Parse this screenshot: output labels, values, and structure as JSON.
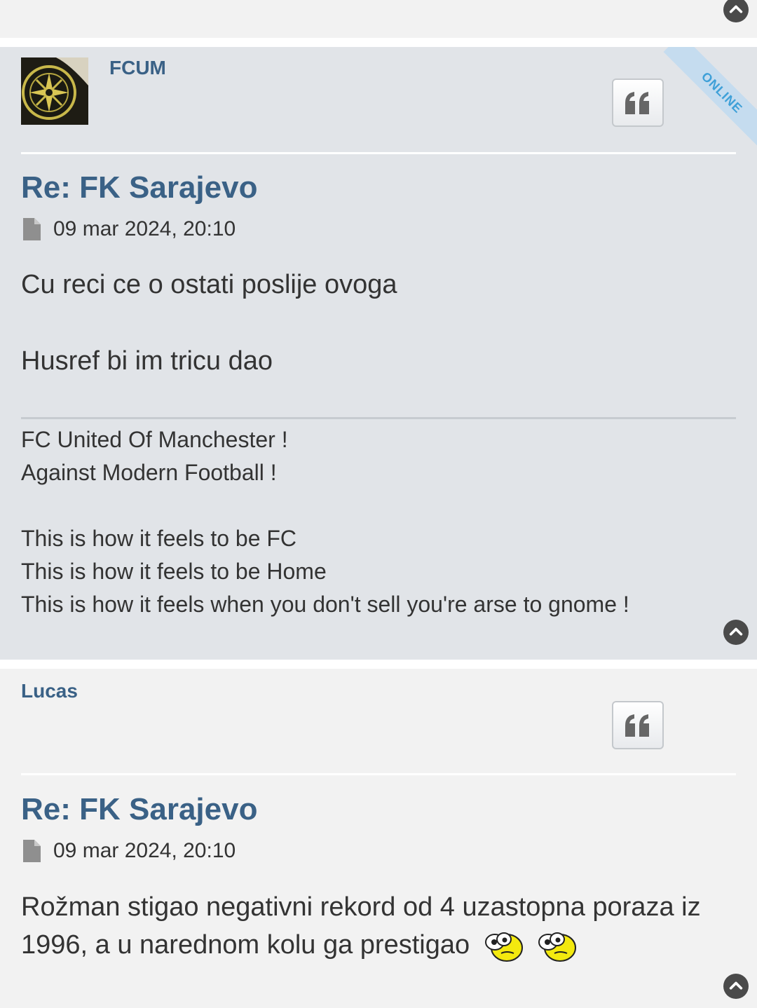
{
  "posts": [
    {
      "author": "FCUM",
      "online_label": "ONLINE",
      "title": "Re: FK Sarajevo",
      "date": "09 mar 2024, 20:10",
      "content": [
        "Cu reci ce o ostati poslije ovoga",
        "Husref bi im tricu dao"
      ],
      "signature": [
        "FC United Of Manchester !",
        "Against Modern Football !",
        "",
        "This is how it feels to be FC",
        "This is how it feels to be Home",
        "This is how it feels when you don't sell you're arse to gnome !"
      ]
    },
    {
      "author": "Lucas",
      "title": "Re: FK Sarajevo",
      "date": "09 mar 2024, 20:10",
      "content": "Rožman stigao negativni rekord od 4 uzastopna poraza iz 1996, a u narednom kolu ga prestigao"
    }
  ],
  "icons": {
    "back_to_top": "chevron-up-circle-icon",
    "quote": "quote-icon",
    "post_file": "file-icon",
    "smiley": "wacko-smiley-icon"
  },
  "colors": {
    "accent": "#3a6186",
    "post_bg_alt": "#e1e4e8",
    "post_bg": "#f2f2f2",
    "online": "#3ea0d8"
  }
}
